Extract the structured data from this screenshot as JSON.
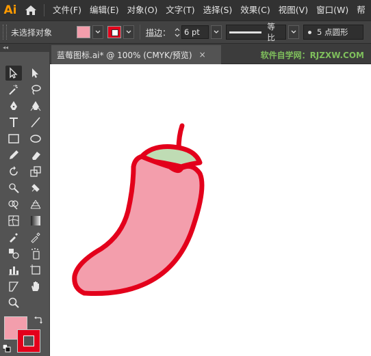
{
  "app": {
    "logo": "Ai"
  },
  "menu": {
    "items": [
      "文件(F)",
      "编辑(E)",
      "对象(O)",
      "文字(T)",
      "选择(S)",
      "效果(C)",
      "视图(V)",
      "窗口(W)",
      "帮"
    ]
  },
  "control_bar": {
    "selection_status": "未选择对象",
    "fill_color": "#f39eac",
    "stroke_color": "#e3001b",
    "stroke_label": "描边",
    "stroke_label_colon": "：",
    "stroke_weight": "6 pt",
    "profile_label": "等比",
    "brush_label": "5 点圆形"
  },
  "toolbar": {
    "collapse_label": "◂◂",
    "tools": [
      "selection-tool",
      "direct-selection-tool",
      "magic-wand-tool",
      "lasso-tool",
      "pen-tool",
      "curvature-tool",
      "type-tool",
      "line-tool",
      "rectangle-tool",
      "ellipse-tool",
      "pencil-tool",
      "eraser-tool",
      "rotate-tool",
      "scale-tool",
      "warp-tool",
      "puppet-warp-tool",
      "shape-builder-tool",
      "perspective-grid-tool",
      "mesh-tool",
      "gradient-tool",
      "eyedropper-tool",
      "measure-tool",
      "blend-tool",
      "symbol-sprayer-tool",
      "column-graph-tool",
      "artboard-tool",
      "slice-tool",
      "hand-tool",
      "zoom-tool"
    ],
    "fill_color": "#f39eac",
    "stroke_color": "#e3001b"
  },
  "document": {
    "tab_title": "蓝莓图标.ai* @ 100% (CMYK/预览)",
    "close_label": "×",
    "watermark": "软件自学网：RJZXW.COM",
    "watermark_color": "#7fbf5c"
  },
  "artwork": {
    "subject": "chili pepper",
    "body_fill": "#f39eac",
    "cap_fill": "#bfdcb4",
    "outline": "#e3001b"
  }
}
